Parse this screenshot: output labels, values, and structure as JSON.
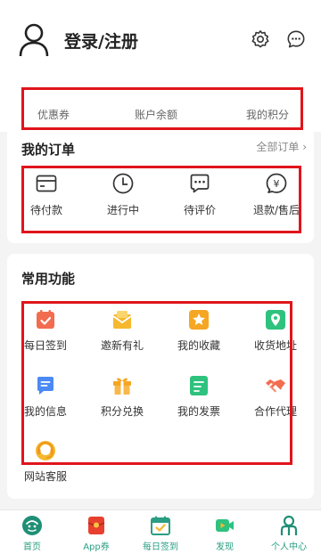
{
  "header": {
    "login_label": "登录/注册",
    "icons": [
      "user-avatar-icon",
      "gear-icon",
      "chat-icon"
    ]
  },
  "stats": [
    {
      "value": "--",
      "label": "优惠券"
    },
    {
      "value": "--",
      "label": "账户余额"
    },
    {
      "value": "--",
      "label": "我的积分"
    }
  ],
  "orders": {
    "title": "我的订单",
    "all_orders": "全部订单 ›",
    "items": [
      {
        "label": "待付款",
        "icon": "card-icon"
      },
      {
        "label": "进行中",
        "icon": "clock-icon"
      },
      {
        "label": "待评价",
        "icon": "comment-icon"
      },
      {
        "label": "退款/售后",
        "icon": "refund-icon"
      }
    ]
  },
  "functions": {
    "title": "常用功能",
    "items": [
      {
        "label": "每日签到",
        "icon": "checkin-icon",
        "color": "#f26c4f"
      },
      {
        "label": "邀新有礼",
        "icon": "envelope-gift-icon",
        "color": "#f5b82e"
      },
      {
        "label": "我的收藏",
        "icon": "star-icon",
        "color": "#f5a623"
      },
      {
        "label": "收货地址",
        "icon": "location-icon",
        "color": "#2ec27e"
      },
      {
        "label": "我的信息",
        "icon": "message-icon",
        "color": "#4a8af4"
      },
      {
        "label": "积分兑换",
        "icon": "gift-icon",
        "color": "#f5a623"
      },
      {
        "label": "我的发票",
        "icon": "invoice-icon",
        "color": "#2ec27e"
      },
      {
        "label": "合作代理",
        "icon": "handshake-icon",
        "color": "#f26c4f"
      },
      {
        "label": "网站客服",
        "icon": "headset-icon",
        "color": "#f5b82e"
      }
    ]
  },
  "tabbar": [
    {
      "label": "首页",
      "icon": "home-icon"
    },
    {
      "label": "App券",
      "icon": "coupon-icon"
    },
    {
      "label": "每日签到",
      "icon": "calendar-check-icon"
    },
    {
      "label": "发现",
      "icon": "video-icon"
    },
    {
      "label": "个人中心",
      "icon": "person-icon"
    }
  ],
  "accent_color": "#2a9d83",
  "highlight_color": "#e0151b"
}
